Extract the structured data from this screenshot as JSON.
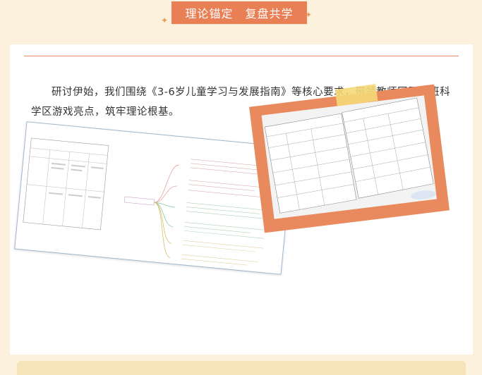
{
  "header": {
    "title": "理论锚定　复盘共学"
  },
  "body": {
    "paragraph": "研讨伊始，我们围绕《3-6岁儿童学习与发展指南》等核心要求，带领教师回顾各班科学区游戏亮点，筑牢理论根基。"
  },
  "colors": {
    "accent": "#e97f55",
    "page_bg": "#fbf1dd",
    "tape": "#f5d878"
  }
}
